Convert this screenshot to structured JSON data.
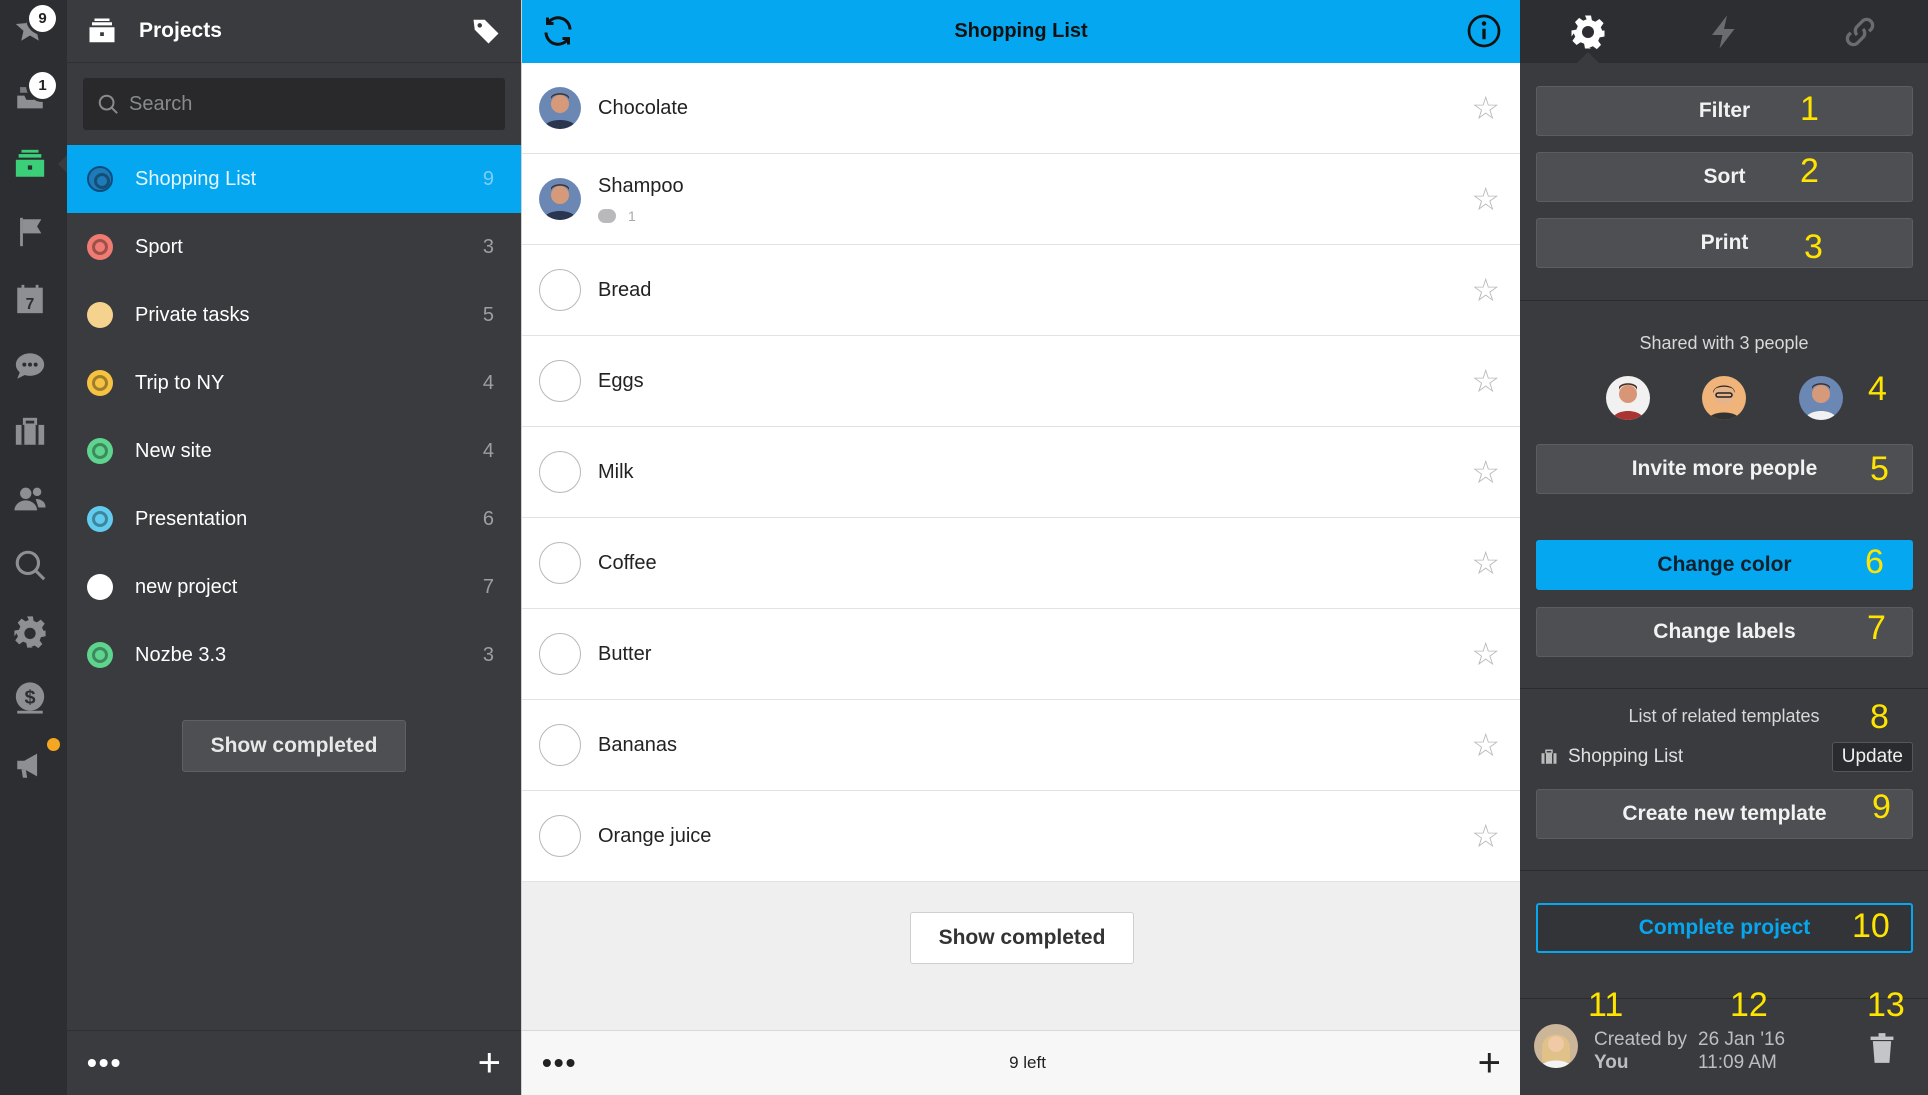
{
  "rail": {
    "starred_badge": "9",
    "inbox_badge": "1",
    "calendar_day": "7"
  },
  "projects_panel": {
    "title": "Projects",
    "search_placeholder": "Search",
    "show_completed": "Show completed",
    "more": "•••",
    "add": "+",
    "items": [
      {
        "name": "Shopping List",
        "count": "9",
        "color": "#1e7bb8",
        "active": true
      },
      {
        "name": "Sport",
        "count": "3",
        "color": "#f07b72"
      },
      {
        "name": "Private tasks",
        "count": "5",
        "color": "#f6d28f"
      },
      {
        "name": "Trip to NY",
        "count": "4",
        "color": "#f5c242"
      },
      {
        "name": "New site",
        "count": "4",
        "color": "#5fd48f"
      },
      {
        "name": "Presentation",
        "count": "6",
        "color": "#62ccef"
      },
      {
        "name": "new project",
        "count": "7",
        "color": "#ffffff"
      },
      {
        "name": "Nozbe 3.3",
        "count": "3",
        "color": "#5fd48f"
      }
    ]
  },
  "task_panel": {
    "title": "Shopping List",
    "show_completed": "Show completed",
    "left_count": "9 left",
    "more": "•••",
    "add": "+",
    "tasks": [
      {
        "name": "Chocolate",
        "assigned": true,
        "comments": ""
      },
      {
        "name": "Shampoo",
        "assigned": true,
        "comments": "1"
      },
      {
        "name": "Bread"
      },
      {
        "name": "Eggs"
      },
      {
        "name": "Milk"
      },
      {
        "name": "Coffee"
      },
      {
        "name": "Butter"
      },
      {
        "name": "Bananas"
      },
      {
        "name": "Orange juice"
      }
    ]
  },
  "settings_panel": {
    "filter": "Filter",
    "sort": "Sort",
    "print": "Print",
    "shared_with": "Shared with 3 people",
    "invite": "Invite more people",
    "change_color": "Change color",
    "change_labels": "Change labels",
    "templates_title": "List of related templates",
    "template_name": "Shopping List",
    "template_update": "Update",
    "create_template": "Create new template",
    "complete_project": "Complete project",
    "created_by_label": "Created by",
    "created_by_user": "You",
    "created_date": "26 Jan '16",
    "created_time": "11:09 AM",
    "annotations": [
      "1",
      "2",
      "3",
      "4",
      "5",
      "6",
      "7",
      "8",
      "9",
      "10",
      "11",
      "12",
      "13"
    ]
  },
  "colors": {
    "accent": "#05a8f0",
    "annotation": "#ffe400"
  }
}
